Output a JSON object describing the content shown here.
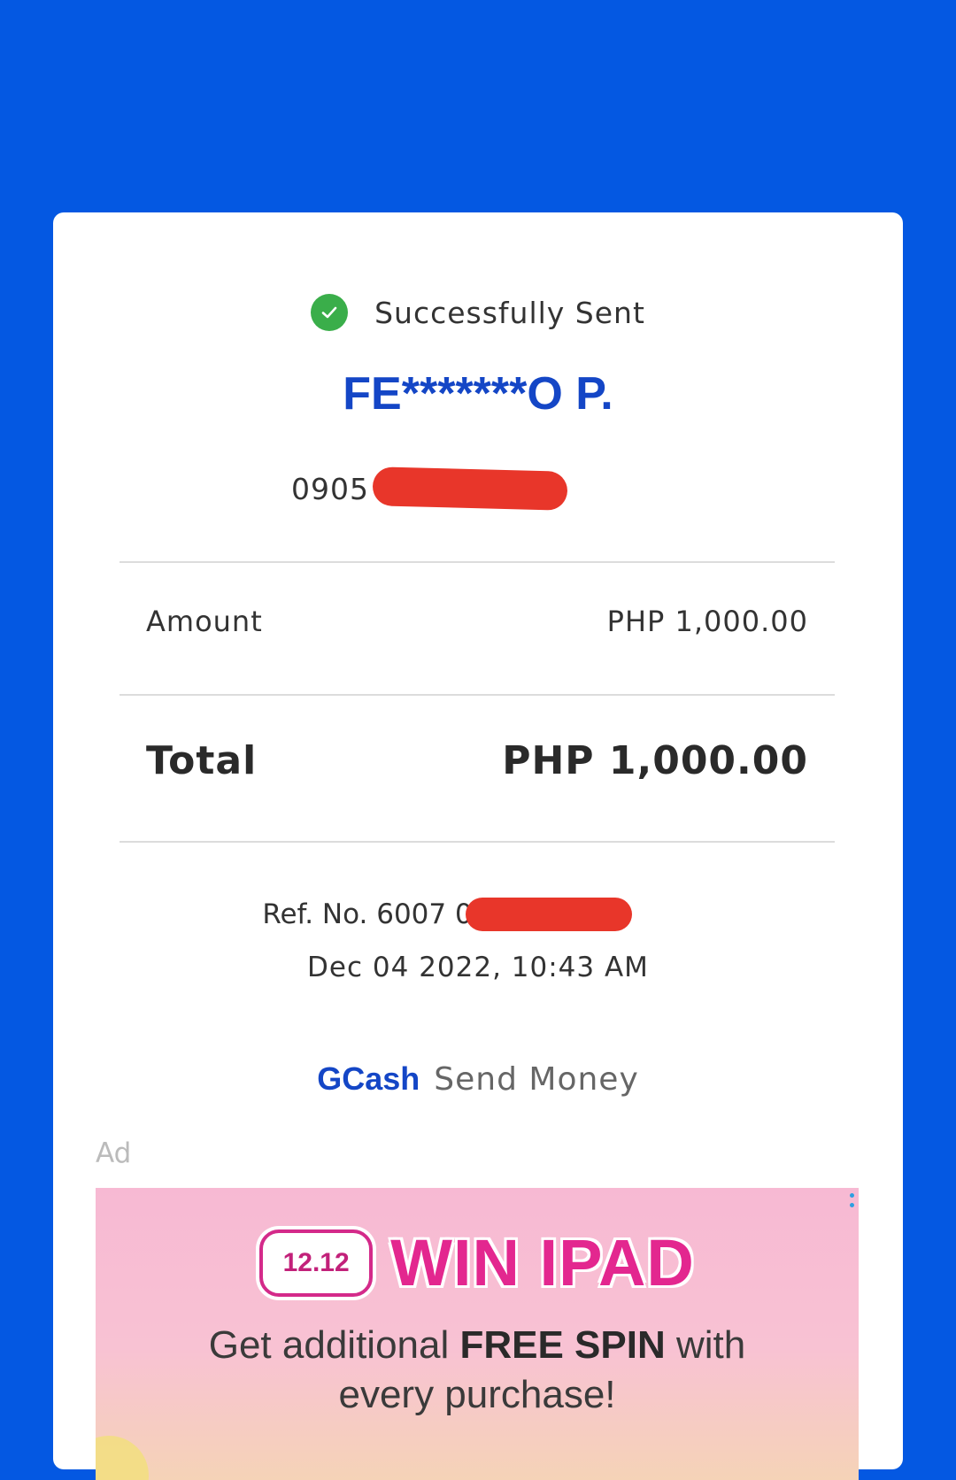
{
  "receipt": {
    "status": "Successfully Sent",
    "recipient_name": "FE*******O P.",
    "phone_prefix": "0905",
    "amount_label": "Amount",
    "amount_value": "PHP 1,000.00",
    "total_label": "Total",
    "total_value": "PHP 1,000.00",
    "ref_prefix": "Ref. No. 6007 0",
    "datetime": "Dec 04 2022, 10:43 AM",
    "brand": "GCash",
    "service": "Send Money"
  },
  "ad": {
    "label": "Ad",
    "badge": "12.12",
    "headline": "WIN IPAD",
    "subline_pre": "Get additional ",
    "subline_bold": "FREE SPIN",
    "subline_post": " with",
    "subline_line2": "every purchase!"
  },
  "colors": {
    "background": "#0458E2",
    "brand_blue": "#1446C6",
    "success_green": "#3AAE4A",
    "redaction_red": "#E8362A",
    "ad_pink": "#E3278F"
  },
  "icons": {
    "status": "check-circle-icon",
    "ad_menu": "more-vertical-icon"
  }
}
